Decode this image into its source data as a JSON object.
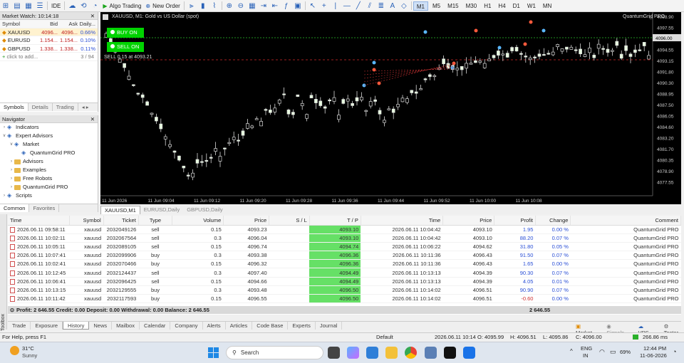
{
  "toolbar": {
    "ide_label": "IDE",
    "algo_label": "Algo Trading",
    "neworder_label": "New Order",
    "timeframes": [
      "M1",
      "M5",
      "M15",
      "M30",
      "H1",
      "H4",
      "D1",
      "W1",
      "MN"
    ],
    "active_tf": "M1"
  },
  "market_watch": {
    "title": "Market Watch: 10:14:18",
    "headers": [
      "Symbol",
      "Bid",
      "Ask",
      "Daily..."
    ],
    "rows": [
      {
        "symbol": "XAUUSD",
        "bid": "4096...",
        "ask": "4096...",
        "daily": "0.66%",
        "color": "#2a4fd6"
      },
      {
        "symbol": "EURUSD",
        "bid": "1.154...",
        "ask": "1.154...",
        "daily": "0.10%",
        "color": "#2a4fd6"
      },
      {
        "symbol": "GBPUSD",
        "bid": "1.338...",
        "ask": "1.338...",
        "daily": "0.11%",
        "color": "#2a4fd6"
      }
    ],
    "add_label": "click to add...",
    "count": "3 / 94",
    "tabs": [
      "Symbols",
      "Details",
      "Trading"
    ]
  },
  "navigator": {
    "title": "Navigator",
    "items": [
      {
        "label": "Indicators",
        "indent": 1,
        "arrow": "›",
        "kind": "ico"
      },
      {
        "label": "Expert Advisors",
        "indent": 1,
        "arrow": "v",
        "kind": "ico"
      },
      {
        "label": "Market",
        "indent": 2,
        "arrow": "v",
        "kind": "ico"
      },
      {
        "label": "QuantumGrid PRO",
        "indent": 3,
        "arrow": "",
        "kind": "ico"
      },
      {
        "label": "Advisors",
        "indent": 2,
        "arrow": "›",
        "kind": "fold"
      },
      {
        "label": "Examples",
        "indent": 2,
        "arrow": "›",
        "kind": "fold"
      },
      {
        "label": "Free Robots",
        "indent": 2,
        "arrow": "›",
        "kind": "fold"
      },
      {
        "label": "QuantumGrid PRO",
        "indent": 2,
        "arrow": "›",
        "kind": "fold"
      },
      {
        "label": "Scripts",
        "indent": 1,
        "arrow": "›",
        "kind": "ico"
      }
    ],
    "tabs": [
      "Common",
      "Favorites"
    ]
  },
  "chart": {
    "title": "XAUUSD, M1:  Gold vs US Dollar (spot)",
    "ea_name": "QuantumGrid PRO",
    "buy_btn": "BUY ON",
    "sell_btn": "SELL ON",
    "sell_label": "SELL 0.15 at 4093.21",
    "price_labels": [
      "4098.90",
      "4097.55",
      "4096.00",
      "4094.55",
      "4093.15",
      "4091.80",
      "4090.30",
      "4088.95",
      "4087.50",
      "4086.05",
      "4084.60",
      "4083.20",
      "4081.70",
      "4080.35",
      "4078.90",
      "4077.55"
    ],
    "current_price": "4096.00",
    "time_labels": [
      "11 Jun 2026",
      "11 Jun 09:04",
      "11 Jun 09:12",
      "11 Jun 09:20",
      "11 Jun 09:28",
      "11 Jun 09:36",
      "11 Jun 09:44",
      "11 Jun 09:52",
      "11 Jun 10:00",
      "11 Jun 10:08"
    ],
    "tabs": [
      "XAUUSD,M1",
      "EURUSD,Daily",
      "GBPUSD,Daily"
    ]
  },
  "trades": {
    "headers": [
      "Time",
      "Symbol",
      "Ticket",
      "Type",
      "Volume",
      "Price",
      "S / L",
      "T / P",
      "Time",
      "Price",
      "Profit",
      "Change",
      "Comment"
    ],
    "rows": [
      [
        "2026.06.11 09:58:11",
        "xauusd",
        "2032049126",
        "sell",
        "0.15",
        "4093.23",
        "",
        "4093.10",
        "2026.06.11 10:04:42",
        "4093.10",
        "1.95",
        "0.00 %",
        "QuantumGrid PRO"
      ],
      [
        "2026.06.11 10:02:11",
        "xauusd",
        "2032067564",
        "sell",
        "0.3",
        "4096.04",
        "",
        "4093.10",
        "2026.06.11 10:04:42",
        "4093.10",
        "88.20",
        "0.07 %",
        "QuantumGrid PRO"
      ],
      [
        "2026.06.11 10:05:11",
        "xauusd",
        "2032089105",
        "sell",
        "0.15",
        "4096.74",
        "",
        "4094.74",
        "2026.06.11 10:06:22",
        "4094.62",
        "31.80",
        "0.05 %",
        "QuantumGrid PRO"
      ],
      [
        "2026.06.11 10:07:41",
        "xauusd",
        "2032099906",
        "buy",
        "0.3",
        "4093.38",
        "",
        "4096.36",
        "2026.06.11 10:11:36",
        "4096.43",
        "91.50",
        "0.07 %",
        "QuantumGrid PRO"
      ],
      [
        "2026.06.11 10:02:41",
        "xauusd",
        "2032070466",
        "buy",
        "0.15",
        "4096.32",
        "",
        "4096.36",
        "2026.06.11 10:11:36",
        "4096.43",
        "1.65",
        "0.00 %",
        "QuantumGrid PRO"
      ],
      [
        "2026.06.11 10:12:45",
        "xauusd",
        "2032124437",
        "sell",
        "0.3",
        "4097.40",
        "",
        "4094.49",
        "2026.06.11 10:13:13",
        "4094.39",
        "90.30",
        "0.07 %",
        "QuantumGrid PRO"
      ],
      [
        "2026.06.11 10:06:41",
        "xauusd",
        "2032096425",
        "sell",
        "0.15",
        "4094.66",
        "",
        "4094.49",
        "2026.06.11 10:13:13",
        "4094.39",
        "4.05",
        "0.01 %",
        "QuantumGrid PRO"
      ],
      [
        "2026.06.11 10:13:15",
        "xauusd",
        "2032129555",
        "buy",
        "0.3",
        "4093.48",
        "",
        "4096.50",
        "2026.06.11 10:14:02",
        "4096.51",
        "90.90",
        "0.07 %",
        "QuantumGrid PRO"
      ],
      [
        "2026.06.11 10:11:42",
        "xauusd",
        "2032117593",
        "buy",
        "0.15",
        "4096.55",
        "",
        "4096.50",
        "2026.06.11 10:14:02",
        "4096.51",
        "-0.60",
        "0.00 %",
        "QuantumGrid PRO"
      ]
    ],
    "summary": "Profit: 2 646.55  Credit: 0.00  Deposit: 0.00  Withdrawal: 0.00  Balance: 2 646.55",
    "summary_total": "2 646.55"
  },
  "bottom_tabs": [
    "Trade",
    "Exposure",
    "History",
    "News",
    "Mailbox",
    "Calendar",
    "Company",
    "Alerts",
    "Articles",
    "Code Base",
    "Experts",
    "Journal"
  ],
  "active_bottom_tab": "History",
  "bottom_right": {
    "market": "Market",
    "signals": "Signals",
    "vps": "VPS",
    "tester": "Tester"
  },
  "toolbox_label": "Toolbox",
  "status": {
    "help": "For Help, press F1",
    "profile": "Default",
    "datetime": "2026.06.11 10:14",
    "o": "O: 4095.99",
    "h": "H: 4096.51",
    "l": "L: 4095.86",
    "c": "C: 4096.00",
    "ping": "266.86 ms"
  },
  "taskbar": {
    "weather_temp": "31°C",
    "weather_desc": "Sunny",
    "search": "Search",
    "lang1": "ENG",
    "lang2": "IN",
    "battery": "69%",
    "time": "12:44 PM",
    "date": "11-06-2026"
  }
}
